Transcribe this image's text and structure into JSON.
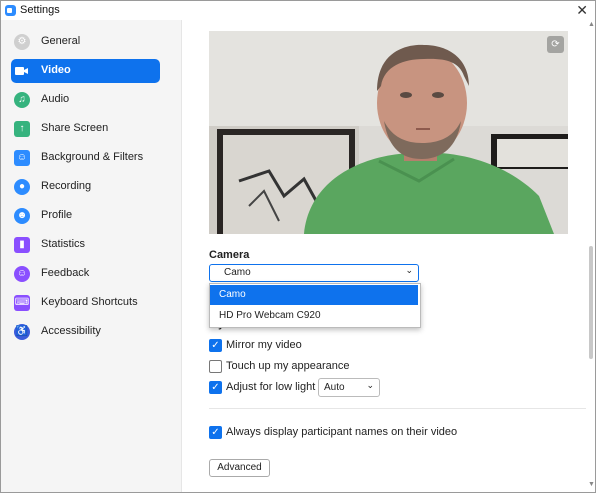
{
  "window": {
    "title": "Settings"
  },
  "sidebar": {
    "items": [
      {
        "label": "General",
        "icon": "gear-icon",
        "color": "#cfcfcf"
      },
      {
        "label": "Video",
        "icon": "video-camera-icon",
        "color": "#0e72ed"
      },
      {
        "label": "Audio",
        "icon": "headphones-icon",
        "color": "#36b37e"
      },
      {
        "label": "Share Screen",
        "icon": "share-screen-icon",
        "color": "#36b37e"
      },
      {
        "label": "Background & Filters",
        "icon": "person-icon",
        "color": "#2d8cff"
      },
      {
        "label": "Recording",
        "icon": "record-icon",
        "color": "#2d8cff"
      },
      {
        "label": "Profile",
        "icon": "profile-icon",
        "color": "#2d8cff"
      },
      {
        "label": "Statistics",
        "icon": "stats-icon",
        "color": "#8a4fff"
      },
      {
        "label": "Feedback",
        "icon": "smile-icon",
        "color": "#8a4fff"
      },
      {
        "label": "Keyboard Shortcuts",
        "icon": "keyboard-icon",
        "color": "#8a4fff"
      },
      {
        "label": "Accessibility",
        "icon": "accessibility-icon",
        "color": "#3b5bdb"
      }
    ]
  },
  "camera": {
    "label": "Camera",
    "selected": "Camo",
    "options": [
      "Camo",
      "HD Pro Webcam C920"
    ]
  },
  "my_video": {
    "label": "My Video",
    "mirror": {
      "label": "Mirror my video",
      "checked": true
    },
    "touch_up": {
      "label": "Touch up my appearance",
      "checked": false
    },
    "low_light": {
      "label": "Adjust for low light",
      "checked": true,
      "mode": "Auto"
    }
  },
  "names": {
    "label": "Always display participant names on their video",
    "checked": true
  },
  "advanced_label": "Advanced",
  "accent_color": "#0e72ed"
}
